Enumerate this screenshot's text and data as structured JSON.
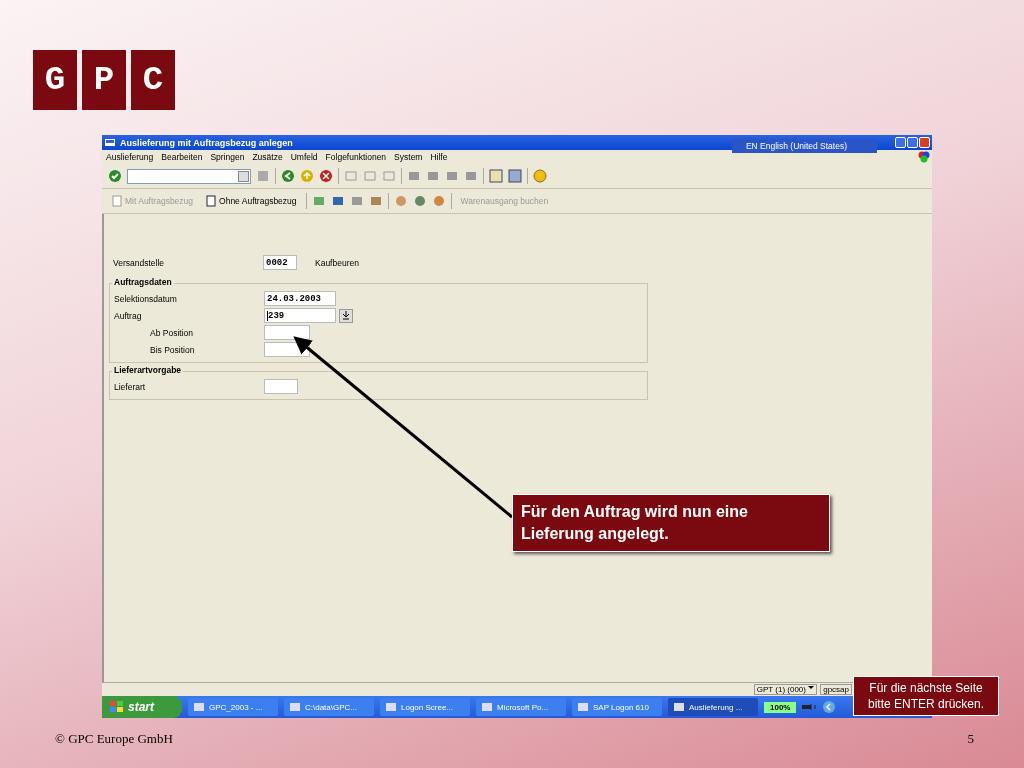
{
  "logo": {
    "letters": [
      "G",
      "P",
      "C"
    ]
  },
  "window": {
    "title": "Auslieferung mit Auftragsbezug anlegen",
    "language_bar": "EN English (United States)"
  },
  "menu": [
    "Auslieferung",
    "Bearbeiten",
    "Springen",
    "Zusätze",
    "Umfeld",
    "Folgefunktionen",
    "System",
    "Hilfe"
  ],
  "app_toolbar": [
    {
      "label": "Mit Auftragsbezug",
      "disabled": true,
      "kind": "doc"
    },
    {
      "label": "Ohne Auftragsbezug",
      "disabled": false,
      "kind": "doc"
    },
    {
      "label": "Warenausgang buchen",
      "disabled": true,
      "kind": "text"
    }
  ],
  "header_field": {
    "label": "Versandstelle",
    "value": "0002",
    "description": "Kaufbeuren",
    "kind": "code"
  },
  "groups": [
    {
      "title": "Auftragsdaten",
      "fields": [
        {
          "label": "Selektionsdatum",
          "value": "24.03.2003",
          "kind": "date",
          "help": false,
          "cursor": false
        },
        {
          "label": "Auftrag",
          "value": "239",
          "kind": "date",
          "help": true,
          "cursor": true,
          "children": [
            {
              "label": "Ab Position",
              "kind": "position",
              "help": false,
              "cursor": false
            },
            {
              "label": "Bis Position",
              "kind": "position",
              "help": false,
              "cursor": false
            }
          ]
        }
      ]
    },
    {
      "title": "Lieferartvorgabe",
      "fields": [
        {
          "label": "Lieferart",
          "kind": "code",
          "help": false,
          "cursor": false
        }
      ]
    }
  ],
  "status_bar": {
    "system": "GPT (1) (000)",
    "server": "gpcsap"
  },
  "taskbar": {
    "start": "start",
    "tasks": [
      {
        "label": "GPC_2003 - ...",
        "selected": false
      },
      {
        "label": "C:\\data\\GPC...",
        "selected": false
      },
      {
        "label": "Logon Scree...",
        "selected": false
      },
      {
        "label": "Microsoft Po...",
        "selected": false
      },
      {
        "label": "SAP Logon 610",
        "selected": false
      },
      {
        "label": "Auslieferung ...",
        "selected": true
      }
    ],
    "battery": "100%"
  },
  "callouts": [
    {
      "text": "Für den Auftrag wird nun eine Lieferung angelegt.",
      "kind": "main"
    },
    {
      "text": "Für die nächste Seite bitte ENTER drücken.",
      "kind": "hint"
    }
  ],
  "footer": {
    "copyright": "© GPC Europe GmbH",
    "page": "5"
  }
}
